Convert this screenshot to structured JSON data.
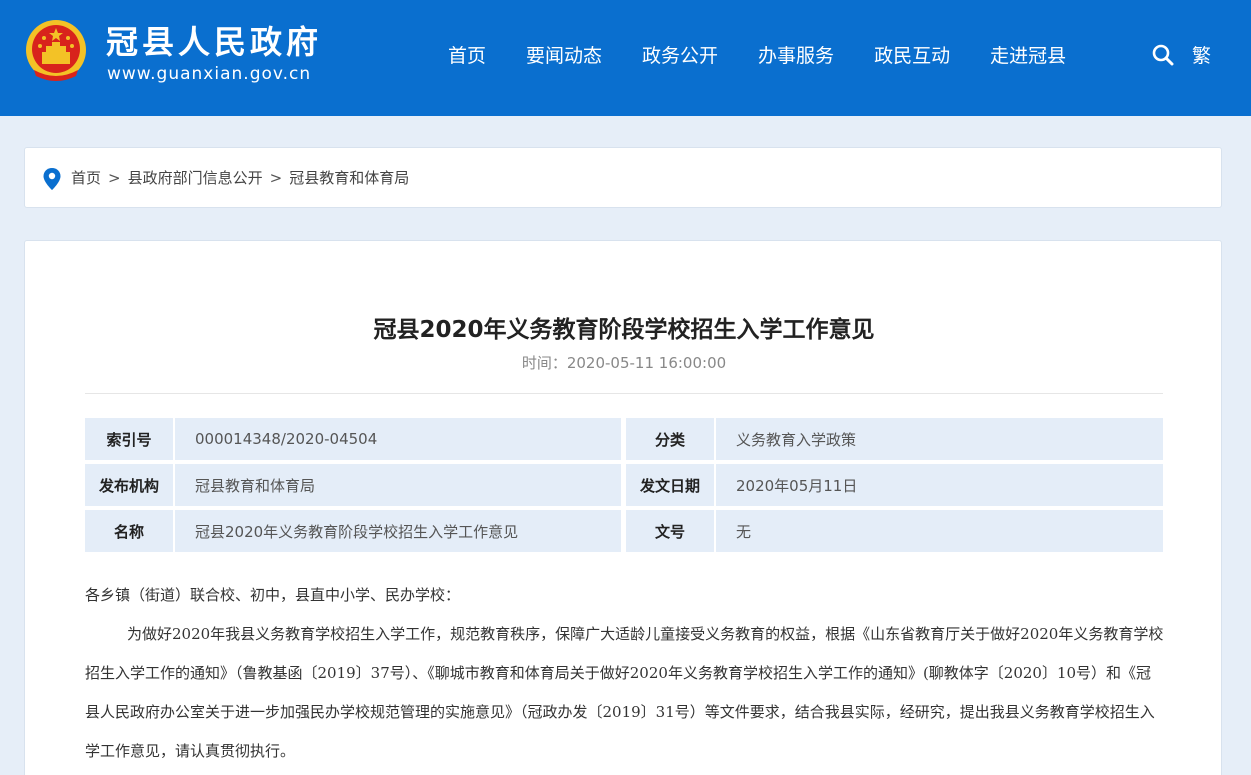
{
  "header": {
    "site_title": "冠县人民政府",
    "site_url": "www.guanxian.gov.cn",
    "nav": [
      "首页",
      "要闻动态",
      "政务公开",
      "办事服务",
      "政民互动",
      "走进冠县"
    ],
    "traditional_label": "繁",
    "emblem_icon": "national-emblem-icon",
    "search_icon": "search-icon",
    "colors": {
      "header_bg": "#0a6fcf",
      "page_bg": "#e6eef8",
      "table_bg": "#e4edf8"
    }
  },
  "breadcrumb": {
    "icon": "location-pin-icon",
    "items": [
      "首页",
      "县政府部门信息公开",
      "冠县教育和体育局"
    ],
    "separator": ">"
  },
  "article": {
    "title": "冠县2020年义务教育阶段学校招生入学工作意见",
    "meta_label": "时间：",
    "meta_value": "2020-05-11 16:00:00",
    "info": {
      "index_label": "索引号",
      "index_value": "000014348/2020-04504",
      "category_label": "分类",
      "category_value": "义务教育入学政策",
      "publisher_label": "发布机构",
      "publisher_value": "冠县教育和体育局",
      "date_label": "发文日期",
      "date_value": "2020年05月11日",
      "name_label": "名称",
      "name_value": "冠县2020年义务教育阶段学校招生入学工作意见",
      "docno_label": "文号",
      "docno_value": "无"
    },
    "salutation": "各乡镇（街道）联合校、初中，县直中小学、民办学校：",
    "paragraph1": "为做好2020年我县义务教育学校招生入学工作，规范教育秩序，保障广大适龄儿童接受义务教育的权益，根据《山东省教育厅关于做好2020年义务教育学校招生入学工作的通知》（鲁教基函〔2019〕37号）、《聊城市教育和体育局关于做好2020年义务教育学校招生入学工作的通知》(聊教体字〔2020〕10号）和《冠县人民政府办公室关于进一步加强民办学校规范管理的实施意见》（冠政办发〔2019〕31号）等文件要求，结合我县实际，经研究，提出我县义务教育学校招生入学工作意见，请认真贯彻执行。"
  }
}
